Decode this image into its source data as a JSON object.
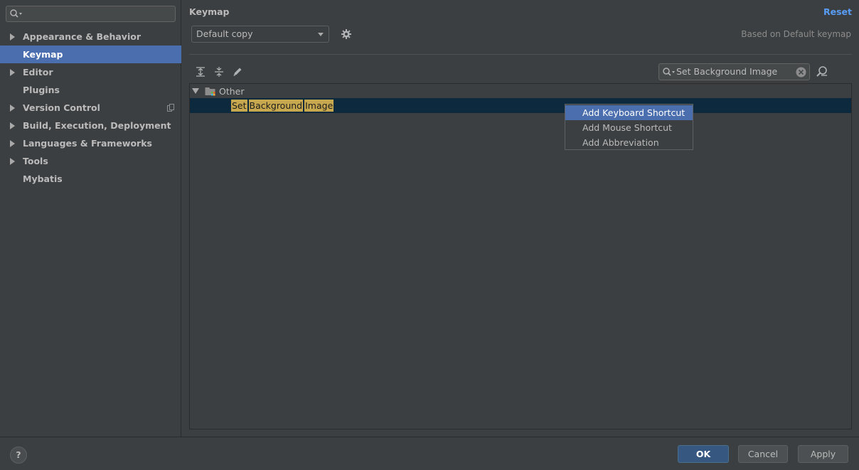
{
  "sidebar": {
    "search_placeholder": "",
    "items": [
      {
        "label": "Appearance & Behavior"
      },
      {
        "label": "Keymap"
      },
      {
        "label": "Editor"
      },
      {
        "label": "Plugins"
      },
      {
        "label": "Version Control"
      },
      {
        "label": "Build, Execution, Deployment"
      },
      {
        "label": "Languages & Frameworks"
      },
      {
        "label": "Tools"
      },
      {
        "label": "Mybatis"
      }
    ]
  },
  "header": {
    "title": "Keymap",
    "reset_label": "Reset",
    "keymap_value": "Default copy",
    "based_on": "Based on Default keymap"
  },
  "filter": {
    "value": "Set Background Image"
  },
  "tree": {
    "group_label": "Other",
    "action_words": [
      "Set",
      "Background",
      "Image"
    ]
  },
  "popup": {
    "items": [
      "Add Keyboard Shortcut",
      "Add Mouse Shortcut",
      "Add Abbreviation"
    ]
  },
  "footer": {
    "help_label": "?",
    "ok_label": "OK",
    "cancel_label": "Cancel",
    "apply_label": "Apply"
  },
  "colors": {
    "background": "#3c3f41",
    "selection": "#4b6eaf",
    "highlight": "#c8a84e",
    "link": "#589df6"
  }
}
